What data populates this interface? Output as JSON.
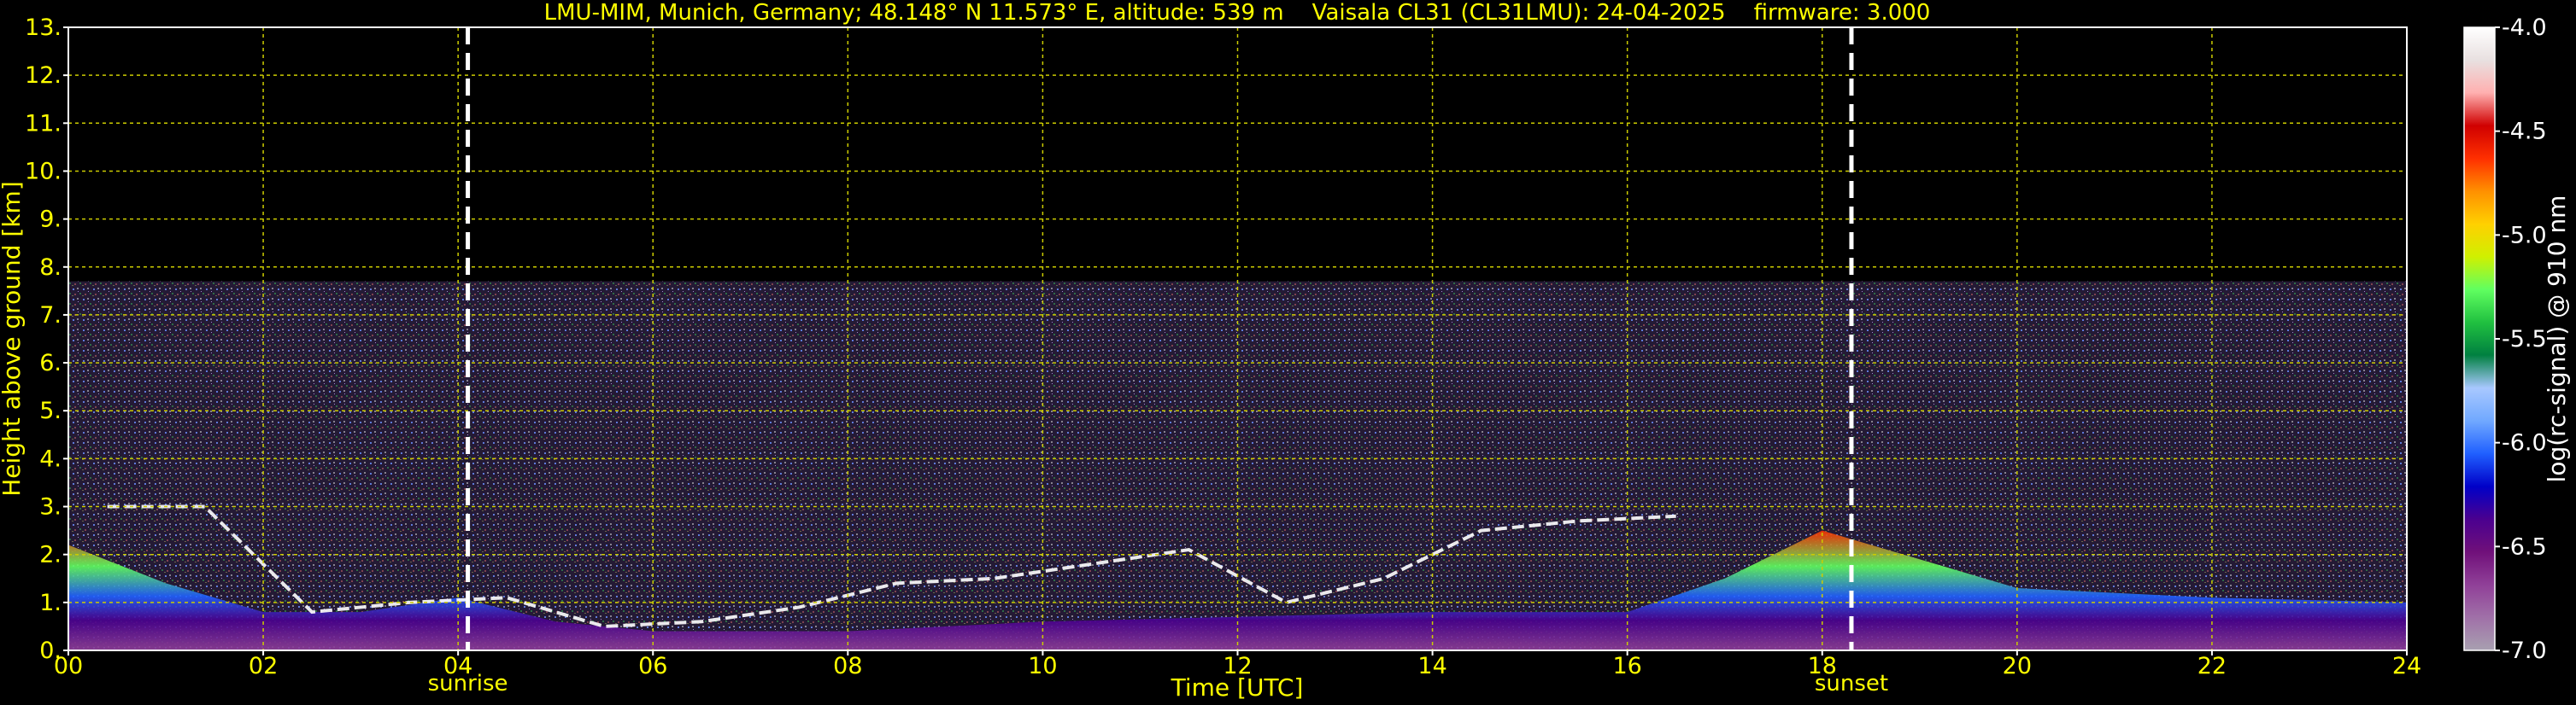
{
  "chart_data": {
    "type": "heatmap",
    "title": "LMU-MIM, Munich, Germany; 48.148° N 11.573° E, altitude: 539 m    Vaisala CL31 (CL31LMU): 24-04-2025    firmware: 3.000",
    "xlabel": "Time [UTC]",
    "ylabel": "Height above ground [km]",
    "xlim": [
      0,
      24
    ],
    "ylim": [
      0,
      13
    ],
    "x_ticks": [
      0,
      2,
      4,
      6,
      8,
      10,
      12,
      14,
      16,
      18,
      20,
      22,
      24
    ],
    "x_tick_labels": [
      "00",
      "02",
      "04",
      "06",
      "08",
      "10",
      "12",
      "14",
      "16",
      "18",
      "20",
      "22",
      "24"
    ],
    "y_ticks": [
      0,
      1,
      2,
      3,
      4,
      5,
      6,
      7,
      8,
      9,
      10,
      11,
      12,
      13
    ],
    "y_tick_labels": [
      "0.",
      "1.",
      "2.",
      "3.",
      "4.",
      "5.",
      "6.",
      "7.",
      "8.",
      "9.",
      "10.",
      "11.",
      "12.",
      "13."
    ],
    "grid": true,
    "grid_color": "#cccc00",
    "text_color": "#ffff00",
    "background": "#000000",
    "measurement_ceiling_km": 7.7,
    "markers": [
      {
        "label": "sunrise",
        "x": 4.1
      },
      {
        "label": "sunset",
        "x": 18.3
      }
    ],
    "colorbar": {
      "label": "log(rc-signal) @ 910 nm",
      "range": [
        -7.0,
        -4.0
      ],
      "ticks": [
        -4.0,
        -4.5,
        -5.0,
        -5.5,
        -6.0,
        -6.5,
        -7.0
      ],
      "tick_labels": [
        "-4.0",
        "-4.5",
        "-5.0",
        "-5.5",
        "-6.0",
        "-6.5",
        "-7.0"
      ],
      "colors": [
        "#a8a0b0",
        "#a070a8",
        "#904098",
        "#70107a",
        "#4a0090",
        "#0000c8",
        "#2060ff",
        "#70a8ff",
        "#a8c8ff",
        "#008040",
        "#20c040",
        "#60ff60",
        "#d0f000",
        "#ffd000",
        "#ff9000",
        "#ff3000",
        "#d00000",
        "#ffb0b0",
        "#e8e0e0",
        "#ffffff"
      ]
    },
    "layers": [
      {
        "name": "boundary-layer-aerosol",
        "x": [
          0,
          1,
          2,
          3,
          4,
          5,
          6,
          8,
          10,
          12,
          14,
          16,
          17,
          18,
          20,
          22,
          24
        ],
        "top_km": [
          2.2,
          1.4,
          0.8,
          0.8,
          1.1,
          0.6,
          0.4,
          0.4,
          0.6,
          0.7,
          0.8,
          0.8,
          1.5,
          2.5,
          1.3,
          1.1,
          1.0
        ]
      },
      {
        "name": "residual-layer-top",
        "x": [
          0.4,
          1.4,
          2.5,
          3.5,
          4.5,
          5.5,
          6.5,
          7.5,
          8.5,
          9.5,
          10.5,
          11.5,
          12.5,
          13.5,
          14.5,
          15.5,
          16.5
        ],
        "height_km": [
          3.0,
          3.0,
          0.8,
          1.0,
          1.1,
          0.5,
          0.6,
          0.9,
          1.4,
          1.5,
          1.8,
          2.1,
          1.0,
          1.5,
          2.5,
          2.7,
          2.8
        ]
      }
    ]
  }
}
